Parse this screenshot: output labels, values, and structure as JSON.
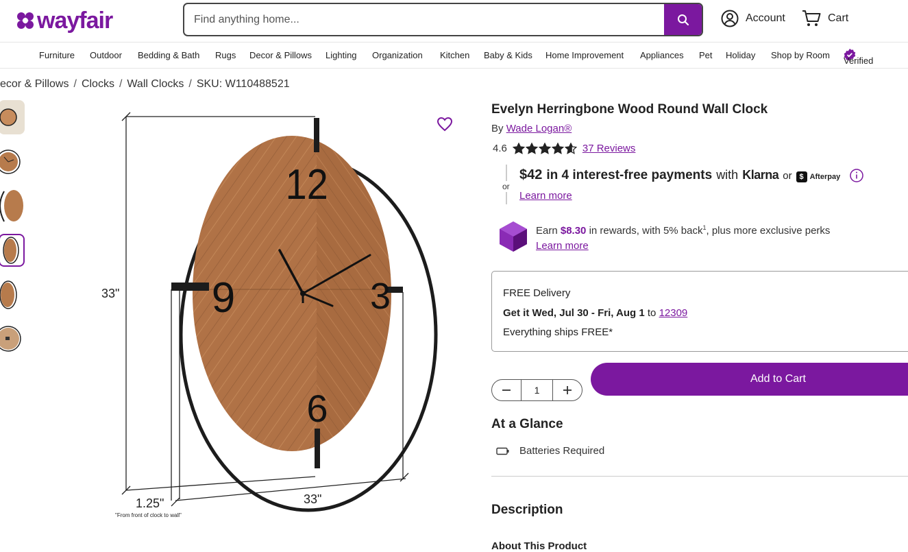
{
  "header": {
    "logo_text": "wayfair",
    "search_placeholder": "Find anything home...",
    "account_label": "Account",
    "cart_label": "Cart"
  },
  "nav": [
    "Furniture",
    "Outdoor",
    "Bedding & Bath",
    "Rugs",
    "Decor & Pillows",
    "Lighting",
    "Organization",
    "Kitchen",
    "Baby & Kids",
    "Home Improvement",
    "Appliances",
    "Pet",
    "Holiday",
    "Shop by Room",
    "Verified"
  ],
  "breadcrumb": [
    "ecor & Pillows",
    "Clocks",
    "Wall Clocks",
    "SKU: W110488521"
  ],
  "image": {
    "dim_height": "33\"",
    "dim_width": "33\"",
    "dim_depth": "1.25\"",
    "dim_note": "\"From front of clock to wall\""
  },
  "product": {
    "title": "Evelyn Herringbone Wood Round Wall Clock",
    "by_prefix": "By",
    "brand": "Wade Logan®",
    "rating": "4.6",
    "rating_value": 4.6,
    "reviews": "37 Reviews"
  },
  "klarna": {
    "or_label": "or",
    "amount": "$42",
    "text": "in 4 interest-free payments",
    "with": "with",
    "klarna_logo": "Klarna",
    "or2": "or",
    "afterpay": "Afterpay",
    "learn_more": "Learn more"
  },
  "rewards": {
    "earn": "Earn",
    "amount": "$8.30",
    "rest": "in rewards, with 5% back",
    "sup": "1",
    "rest2": ", plus more exclusive perks",
    "learn_more": "Learn more"
  },
  "delivery": {
    "free": "FREE Delivery",
    "getit": "Get it Wed, Jul 30 - Fri, Aug 1",
    "to": "to",
    "zip": "12309",
    "ships": "Everything ships FREE*"
  },
  "cart": {
    "qty": "1",
    "add_label": "Add to Cart"
  },
  "sections": {
    "glance": "At a Glance",
    "batteries": "Batteries Required",
    "description": "Description",
    "about": "About This Product"
  },
  "colors": {
    "brand": "#7b189f"
  }
}
